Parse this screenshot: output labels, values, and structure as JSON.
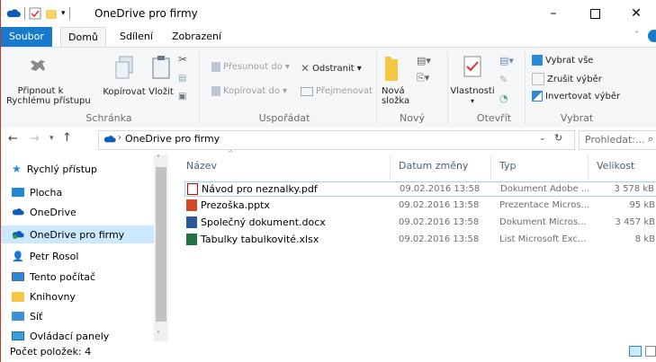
{
  "window": {
    "title": "OneDrive pro firmy"
  },
  "ribbon_tabs": [
    "Soubor",
    "Domů",
    "Sdílení",
    "Zobrazení"
  ],
  "ribbon": {
    "pin_label": "Připnout k\nRychlému přístupu",
    "copy_label": "Kopírovat",
    "paste_label": "Vložit",
    "move_to": "Přesunout do",
    "copy_to": "Kopírovat do",
    "delete": "Odstranit",
    "rename": "Přejmenovat",
    "new_folder": "Nová\nsložka",
    "properties": "Vlastnosti",
    "select_all": "Vybrat vše",
    "select_none": "Zrušit výběr",
    "invert_selection": "Invertovat výběr",
    "groups": [
      "Schránka",
      "Uspořádat",
      "Nový",
      "Otevřít",
      "Vybrat"
    ]
  },
  "address": {
    "path": "OneDrive pro firmy",
    "search_placeholder": "Prohledat:..."
  },
  "nav": {
    "items": [
      "Rychlý přístup",
      "Plocha",
      "OneDrive",
      "OneDrive pro firmy",
      "Petr Rosol",
      "Tento počítač",
      "Knihovny",
      "Síť",
      "Ovládací panely"
    ]
  },
  "columns": [
    "Název",
    "Datum změny",
    "Typ",
    "Velikost"
  ],
  "files": [
    {
      "name": "Návod pro neznalky.pdf",
      "date": "09.02.2016 13:58",
      "type": "Dokument Adobe ...",
      "size": "3 578 kB",
      "icon": "pdf-icon"
    },
    {
      "name": "Prezoška.pptx",
      "date": "09.02.2016 13:58",
      "type": "Prezentace Micros...",
      "size": "95 kB",
      "icon": "pptx-icon"
    },
    {
      "name": "Společný dokument.docx",
      "date": "09.02.2016 13:58",
      "type": "Dokument Micros...",
      "size": "3 457 kB",
      "icon": "docx-icon"
    },
    {
      "name": "Tabulky tabulkovité.xlsx",
      "date": "09.02.2016 13:58",
      "type": "List Microsoft Exc...",
      "size": "8 kB",
      "icon": "xlsx-icon"
    }
  ],
  "status": {
    "count": "Počet položek: 4"
  },
  "colors": {
    "accent": "#1979ca",
    "selection": "#cce8ff",
    "header_text": "#4c607a"
  }
}
